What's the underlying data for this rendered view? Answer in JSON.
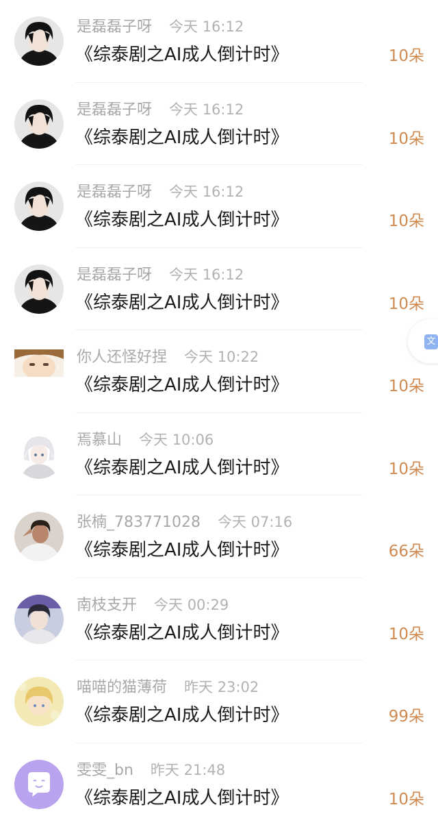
{
  "items": [
    {
      "user": "是磊磊子呀",
      "time": "今天 16:12",
      "title": "《综泰剧之AI成人倒计时》",
      "gift": "10朵",
      "avatar_icon": "avatar-dark-hair-boy-icon"
    },
    {
      "user": "是磊磊子呀",
      "time": "今天 16:12",
      "title": "《综泰剧之AI成人倒计时》",
      "gift": "10朵",
      "avatar_icon": "avatar-dark-hair-boy-icon"
    },
    {
      "user": "是磊磊子呀",
      "time": "今天 16:12",
      "title": "《综泰剧之AI成人倒计时》",
      "gift": "10朵",
      "avatar_icon": "avatar-dark-hair-boy-icon"
    },
    {
      "user": "是磊磊子呀",
      "time": "今天 16:12",
      "title": "《综泰剧之AI成人倒计时》",
      "gift": "10朵",
      "avatar_icon": "avatar-dark-hair-boy-icon"
    },
    {
      "user": "你人还怪好捏",
      "time": "今天 10:22",
      "title": "《综泰剧之AI成人倒计时》",
      "gift": "10朵",
      "avatar_icon": "avatar-anime-face-icon"
    },
    {
      "user": "焉慕山",
      "time": "今天 10:06",
      "title": "《综泰剧之AI成人倒计时》",
      "gift": "10朵",
      "avatar_icon": "avatar-white-hair-anime-icon"
    },
    {
      "user": "张楠_783771028",
      "time": "今天 07:16",
      "title": "《综泰剧之AI成人倒计时》",
      "gift": "66朵",
      "avatar_icon": "avatar-girl-photo-icon"
    },
    {
      "user": "南枝支开",
      "time": "今天 00:29",
      "title": "《综泰剧之AI成人倒计时》",
      "gift": "10朵",
      "avatar_icon": "avatar-boy-photo-icon"
    },
    {
      "user": "喵喵的猫薄荷",
      "time": "昨天 23:02",
      "title": "《综泰剧之AI成人倒计时》",
      "gift": "99朵",
      "avatar_icon": "avatar-blonde-anime-icon"
    },
    {
      "user": "雯雯_bn",
      "time": "昨天 21:48",
      "title": "《综泰剧之AI成人倒计时》",
      "gift": "10朵",
      "avatar_icon": "avatar-default-chat-icon"
    }
  ],
  "floating_button": {
    "icon": "translate-icon",
    "glyph": "文"
  },
  "colors": {
    "gift": "#d08a50",
    "meta": "#a8a8a8",
    "title": "#1a1a1a",
    "divider": "#efefef"
  }
}
